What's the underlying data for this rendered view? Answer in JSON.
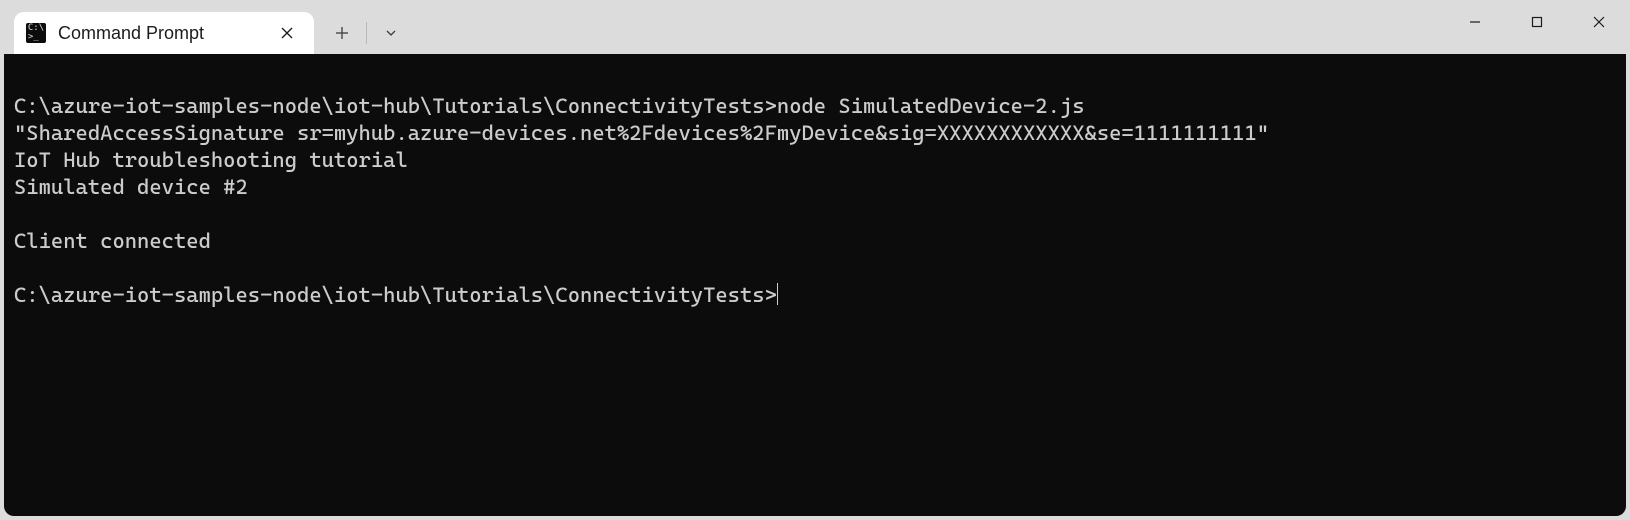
{
  "tab": {
    "title": "Command Prompt",
    "icon_glyph": "C:\\>_"
  },
  "terminal": {
    "lines": [
      "",
      "C:\\azure-iot-samples-node\\iot-hub\\Tutorials\\ConnectivityTests>node SimulatedDevice-2.js",
      "\"SharedAccessSignature sr=myhub.azure-devices.net%2Fdevices%2FmyDevice&sig=XXXXXXXXXXXX&se=1111111111\"",
      "IoT Hub troubleshooting tutorial",
      "Simulated device #2",
      "",
      "Client connected",
      "",
      "C:\\azure-iot-samples-node\\iot-hub\\Tutorials\\ConnectivityTests>"
    ]
  }
}
